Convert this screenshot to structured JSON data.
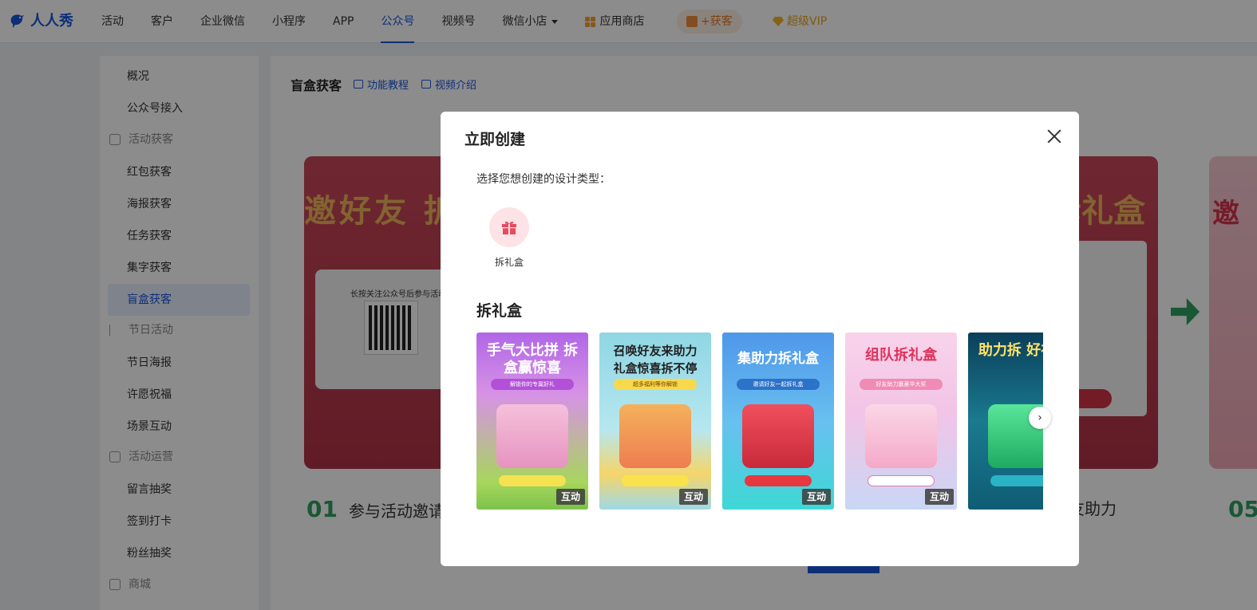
{
  "brand": {
    "name": "人人秀"
  },
  "nav": {
    "items": [
      "活动",
      "客户",
      "企业微信",
      "小程序",
      "APP",
      "公众号",
      "视频号",
      "微信小店",
      "应用商店"
    ],
    "active_index": 5,
    "get_customers": "+获客",
    "vip": "超级VIP"
  },
  "sidebar": {
    "items": [
      {
        "label": "概况",
        "type": "item"
      },
      {
        "label": "公众号接入",
        "type": "item"
      },
      {
        "label": "活动获客",
        "type": "group"
      },
      {
        "label": "红包获客",
        "type": "item"
      },
      {
        "label": "海报获客",
        "type": "item"
      },
      {
        "label": "任务获客",
        "type": "item"
      },
      {
        "label": "集字获客",
        "type": "item"
      },
      {
        "label": "盲盒获客",
        "type": "item",
        "active": true
      },
      {
        "label": "节日活动",
        "type": "group"
      },
      {
        "label": "节日海报",
        "type": "item"
      },
      {
        "label": "许愿祝福",
        "type": "item"
      },
      {
        "label": "场景互动",
        "type": "item"
      },
      {
        "label": "活动运营",
        "type": "group"
      },
      {
        "label": "留言抽奖",
        "type": "item"
      },
      {
        "label": "签到打卡",
        "type": "item"
      },
      {
        "label": "粉丝抽奖",
        "type": "item"
      },
      {
        "label": "商城",
        "type": "group"
      }
    ]
  },
  "main": {
    "title": "盲盒获客",
    "link_tutorial": "功能教程",
    "link_video": "视频介绍",
    "banner_text": "邀好友 拆礼",
    "banner_text_right": "拆礼盒",
    "banner_qr_label": "长按关注公众号后参与活动",
    "step1_num": "01",
    "step1_text": "参与活动邀请",
    "step_right_text": "友助力",
    "step_right_num": "05"
  },
  "modal": {
    "title": "立即创建",
    "subtitle": "选择您想创建的设计类型：",
    "type_option": {
      "label": "拆礼盒",
      "icon": "gift-icon"
    },
    "section_title": "拆礼盒",
    "templates": [
      {
        "title": "手气大比拼 拆盒赢惊喜",
        "subtitle": "解锁你的专属好礼",
        "badge": "互动",
        "bg": "#c38ee0"
      },
      {
        "title": "召唤好友来助力 礼盒惊喜拆不停",
        "subtitle": "超多福利等你解锁",
        "badge": "互动",
        "bg": "#9fd9e6"
      },
      {
        "title": "集助力拆礼盒",
        "subtitle": "邀请好友一起拆礼盒",
        "badge": "互动",
        "bg": "#5ab7ef"
      },
      {
        "title": "组队拆礼盒",
        "subtitle": "好友助力赢豪华大奖",
        "badge": "互动",
        "bg": "#f3c6e4"
      },
      {
        "title": "助力拆 好礼箱",
        "subtitle": "",
        "badge": "",
        "bg": "#0f5c74"
      }
    ]
  }
}
